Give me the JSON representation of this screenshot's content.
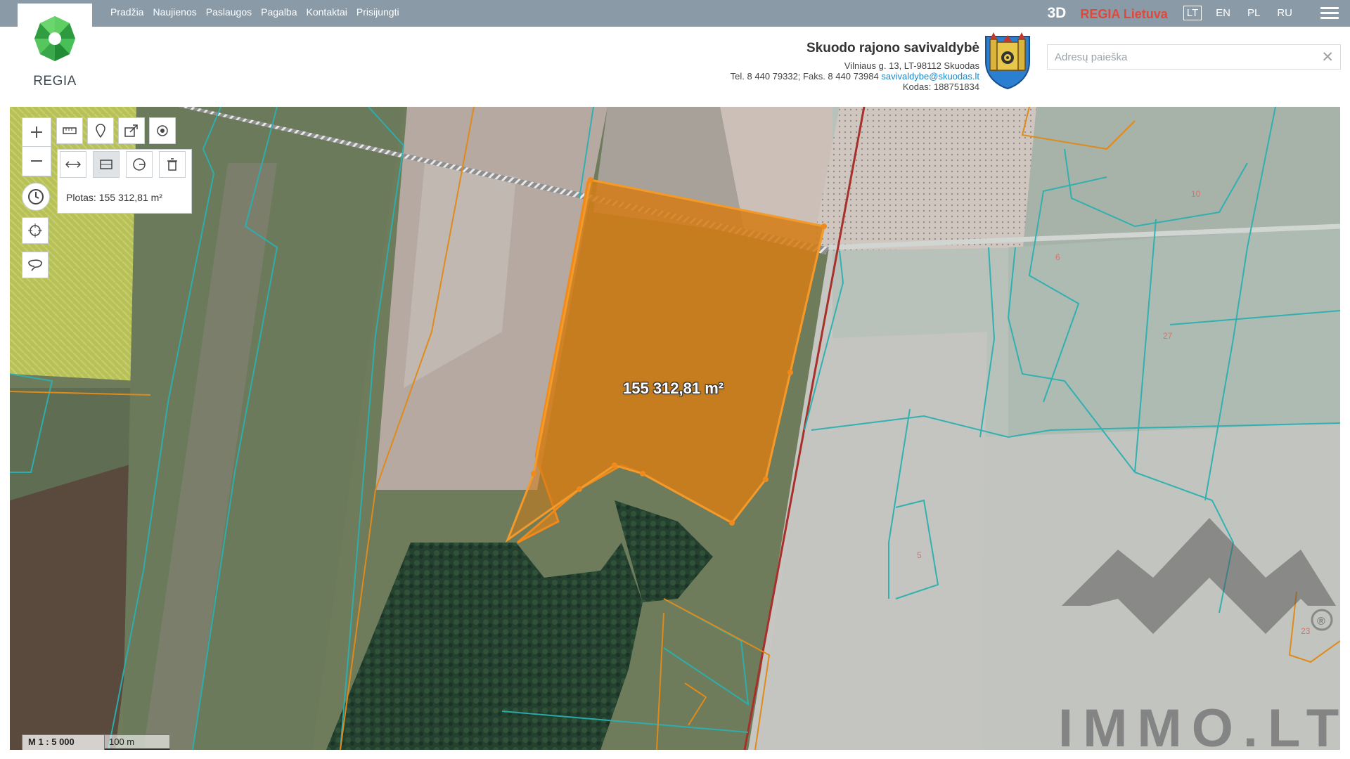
{
  "brand": {
    "logo_text": "REGIA"
  },
  "nav": {
    "items": [
      "Pradžia",
      "Naujienos",
      "Paslaugos",
      "Pagalba",
      "Kontaktai",
      "Prisijungti"
    ]
  },
  "topright": {
    "btn_3d": "3D",
    "regia_lietuva": "REGIA Lietuva",
    "languages": [
      {
        "code": "LT",
        "active": true
      },
      {
        "code": "EN",
        "active": false
      },
      {
        "code": "PL",
        "active": false
      },
      {
        "code": "RU",
        "active": false
      }
    ]
  },
  "municipality": {
    "name": "Skuodo rajono savivaldybė",
    "address": "Vilniaus g. 13, LT-98112 Skuodas",
    "phone_fax": "Tel. 8 440 79332; Faks. 8 440 73984",
    "email": "savivaldybe@skuodas.lt",
    "code": "Kodas: 188751834"
  },
  "search": {
    "placeholder": "Adresų paieška",
    "value": "",
    "clear_icon": "close-icon"
  },
  "map": {
    "measure_result": "Plotas: 155 312,81 m²",
    "area_label": "155 312,81 m²",
    "scale_ratio": "M 1 : 5 000",
    "scale_distance": "100 m",
    "parcel_numbers": [
      "10",
      "6",
      "27",
      "5",
      "23"
    ],
    "highlight_color": "#e08a1a",
    "parcel_boundary_color": "#2ab0b0"
  },
  "tools": {
    "top_row": [
      "ruler-icon",
      "location-pin-icon",
      "share-icon",
      "target-icon"
    ],
    "second_row": [
      "measure-distance-icon",
      "measure-area-icon",
      "measure-radius-icon",
      "trash-icon"
    ],
    "left_column": [
      "history-icon",
      "crosshair-icon",
      "lasso-icon"
    ]
  },
  "watermark": {
    "text": "IMMO.LT",
    "registered": "®"
  }
}
